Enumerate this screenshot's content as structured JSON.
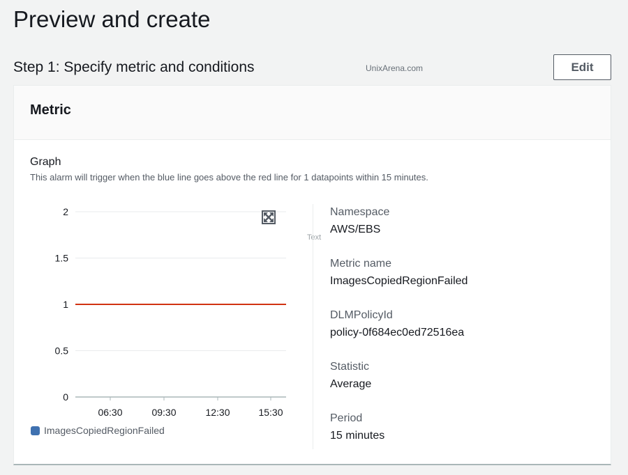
{
  "page": {
    "title": "Preview and create"
  },
  "step": {
    "title": "Step 1: Specify metric and conditions",
    "edit_label": "Edit"
  },
  "watermark": "UnixArena.com",
  "panel": {
    "title": "Metric",
    "graph_title": "Graph",
    "graph_description": "This alarm will trigger when the blue line goes above the red line for 1 datapoints within 15 minutes.",
    "ghost_text": "Text"
  },
  "details": [
    {
      "label": "Namespace",
      "value": "AWS/EBS"
    },
    {
      "label": "Metric name",
      "value": "ImagesCopiedRegionFailed"
    },
    {
      "label": "DLMPolicyId",
      "value": "policy-0f684ec0ed72516ea"
    },
    {
      "label": "Statistic",
      "value": "Average"
    },
    {
      "label": "Period",
      "value": "15 minutes"
    }
  ],
  "icons": {
    "expand": "expand-icon"
  },
  "colors": {
    "threshold": "#d13212",
    "series": "#3f71b0"
  },
  "chart_data": {
    "type": "line",
    "y_ticks": [
      "2",
      "1.5",
      "1",
      "0.5",
      "0"
    ],
    "x_ticks": [
      "06:30",
      "09:30",
      "12:30",
      "15:30"
    ],
    "ylim": [
      0,
      2
    ],
    "grid": true,
    "threshold": 1,
    "series": [
      {
        "name": "ImagesCopiedRegionFailed",
        "values": []
      }
    ],
    "legend": "bottom-left"
  }
}
